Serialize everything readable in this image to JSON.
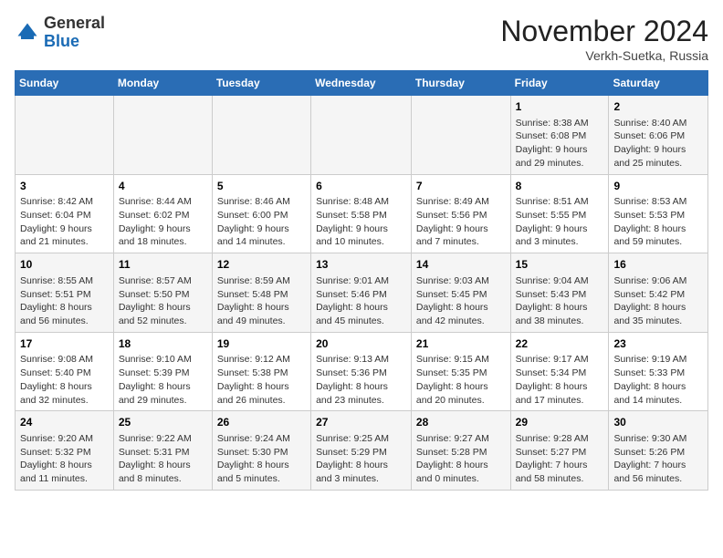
{
  "header": {
    "logo_general": "General",
    "logo_blue": "Blue",
    "month_title": "November 2024",
    "location": "Verkh-Suetka, Russia"
  },
  "days_of_week": [
    "Sunday",
    "Monday",
    "Tuesday",
    "Wednesday",
    "Thursday",
    "Friday",
    "Saturday"
  ],
  "weeks": [
    [
      {
        "day": "",
        "info": ""
      },
      {
        "day": "",
        "info": ""
      },
      {
        "day": "",
        "info": ""
      },
      {
        "day": "",
        "info": ""
      },
      {
        "day": "",
        "info": ""
      },
      {
        "day": "1",
        "info": "Sunrise: 8:38 AM\nSunset: 6:08 PM\nDaylight: 9 hours and 29 minutes."
      },
      {
        "day": "2",
        "info": "Sunrise: 8:40 AM\nSunset: 6:06 PM\nDaylight: 9 hours and 25 minutes."
      }
    ],
    [
      {
        "day": "3",
        "info": "Sunrise: 8:42 AM\nSunset: 6:04 PM\nDaylight: 9 hours and 21 minutes."
      },
      {
        "day": "4",
        "info": "Sunrise: 8:44 AM\nSunset: 6:02 PM\nDaylight: 9 hours and 18 minutes."
      },
      {
        "day": "5",
        "info": "Sunrise: 8:46 AM\nSunset: 6:00 PM\nDaylight: 9 hours and 14 minutes."
      },
      {
        "day": "6",
        "info": "Sunrise: 8:48 AM\nSunset: 5:58 PM\nDaylight: 9 hours and 10 minutes."
      },
      {
        "day": "7",
        "info": "Sunrise: 8:49 AM\nSunset: 5:56 PM\nDaylight: 9 hours and 7 minutes."
      },
      {
        "day": "8",
        "info": "Sunrise: 8:51 AM\nSunset: 5:55 PM\nDaylight: 9 hours and 3 minutes."
      },
      {
        "day": "9",
        "info": "Sunrise: 8:53 AM\nSunset: 5:53 PM\nDaylight: 8 hours and 59 minutes."
      }
    ],
    [
      {
        "day": "10",
        "info": "Sunrise: 8:55 AM\nSunset: 5:51 PM\nDaylight: 8 hours and 56 minutes."
      },
      {
        "day": "11",
        "info": "Sunrise: 8:57 AM\nSunset: 5:50 PM\nDaylight: 8 hours and 52 minutes."
      },
      {
        "day": "12",
        "info": "Sunrise: 8:59 AM\nSunset: 5:48 PM\nDaylight: 8 hours and 49 minutes."
      },
      {
        "day": "13",
        "info": "Sunrise: 9:01 AM\nSunset: 5:46 PM\nDaylight: 8 hours and 45 minutes."
      },
      {
        "day": "14",
        "info": "Sunrise: 9:03 AM\nSunset: 5:45 PM\nDaylight: 8 hours and 42 minutes."
      },
      {
        "day": "15",
        "info": "Sunrise: 9:04 AM\nSunset: 5:43 PM\nDaylight: 8 hours and 38 minutes."
      },
      {
        "day": "16",
        "info": "Sunrise: 9:06 AM\nSunset: 5:42 PM\nDaylight: 8 hours and 35 minutes."
      }
    ],
    [
      {
        "day": "17",
        "info": "Sunrise: 9:08 AM\nSunset: 5:40 PM\nDaylight: 8 hours and 32 minutes."
      },
      {
        "day": "18",
        "info": "Sunrise: 9:10 AM\nSunset: 5:39 PM\nDaylight: 8 hours and 29 minutes."
      },
      {
        "day": "19",
        "info": "Sunrise: 9:12 AM\nSunset: 5:38 PM\nDaylight: 8 hours and 26 minutes."
      },
      {
        "day": "20",
        "info": "Sunrise: 9:13 AM\nSunset: 5:36 PM\nDaylight: 8 hours and 23 minutes."
      },
      {
        "day": "21",
        "info": "Sunrise: 9:15 AM\nSunset: 5:35 PM\nDaylight: 8 hours and 20 minutes."
      },
      {
        "day": "22",
        "info": "Sunrise: 9:17 AM\nSunset: 5:34 PM\nDaylight: 8 hours and 17 minutes."
      },
      {
        "day": "23",
        "info": "Sunrise: 9:19 AM\nSunset: 5:33 PM\nDaylight: 8 hours and 14 minutes."
      }
    ],
    [
      {
        "day": "24",
        "info": "Sunrise: 9:20 AM\nSunset: 5:32 PM\nDaylight: 8 hours and 11 minutes."
      },
      {
        "day": "25",
        "info": "Sunrise: 9:22 AM\nSunset: 5:31 PM\nDaylight: 8 hours and 8 minutes."
      },
      {
        "day": "26",
        "info": "Sunrise: 9:24 AM\nSunset: 5:30 PM\nDaylight: 8 hours and 5 minutes."
      },
      {
        "day": "27",
        "info": "Sunrise: 9:25 AM\nSunset: 5:29 PM\nDaylight: 8 hours and 3 minutes."
      },
      {
        "day": "28",
        "info": "Sunrise: 9:27 AM\nSunset: 5:28 PM\nDaylight: 8 hours and 0 minutes."
      },
      {
        "day": "29",
        "info": "Sunrise: 9:28 AM\nSunset: 5:27 PM\nDaylight: 7 hours and 58 minutes."
      },
      {
        "day": "30",
        "info": "Sunrise: 9:30 AM\nSunset: 5:26 PM\nDaylight: 7 hours and 56 minutes."
      }
    ]
  ]
}
